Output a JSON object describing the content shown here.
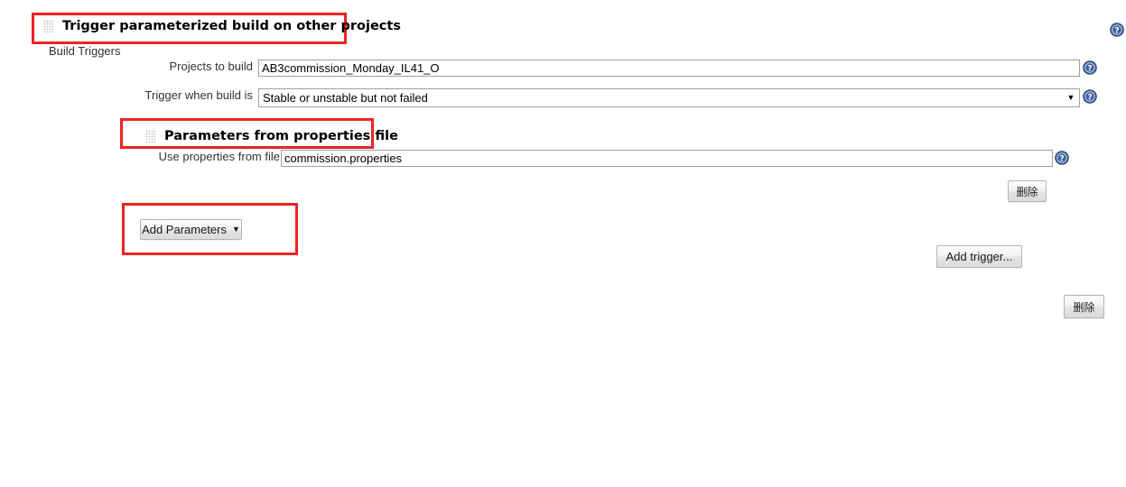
{
  "page": {
    "section_label": "Build Triggers"
  },
  "trigger_section": {
    "heading": "Trigger parameterized build on other projects",
    "grip_icon": "drag-grip-icon",
    "help_icon": "help-icon",
    "fields": [
      {
        "label": "Projects to build",
        "value": "AB3commission_Monday_IL41_O",
        "type": "text"
      },
      {
        "label": "Trigger when build is",
        "value": "Stable or unstable but not failed",
        "type": "select",
        "arrow_glyph": "▼"
      }
    ]
  },
  "parameters_section": {
    "heading": "Parameters from properties file",
    "grip_icon": "drag-grip-icon",
    "field": {
      "label": "Use properties from file",
      "value": "commission.properties"
    },
    "delete_button": "删除",
    "add_parameters_button": "Add Parameters",
    "add_parameters_caret": "▼"
  },
  "footer": {
    "add_trigger_button": "Add trigger...",
    "delete_button": "删除"
  },
  "colors": {
    "annotation_red": "#ee2222",
    "help_blue": "#40629e",
    "input_border": "#a0a0a0",
    "label_text": "#333333"
  }
}
